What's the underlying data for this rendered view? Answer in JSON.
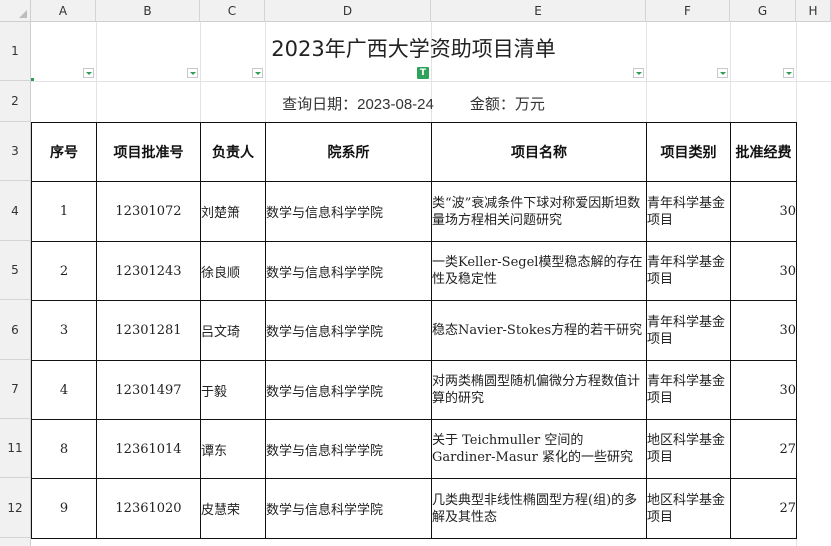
{
  "columns": [
    "A",
    "B",
    "C",
    "D",
    "E",
    "F",
    "G",
    "H"
  ],
  "rows": [
    "1",
    "2",
    "3",
    "4",
    "5",
    "6",
    "7",
    "11",
    "12"
  ],
  "title": "2023年广西大学资助项目清单",
  "subtitle": {
    "date_label": "查询日期：",
    "date_value": "2023-08-24",
    "amount_label": "金额：万元"
  },
  "filter_badge": "T",
  "headers": [
    "序号",
    "项目批准号",
    "负责人",
    "院系所",
    "项目名称",
    "项目类别",
    "批准经费"
  ],
  "records": [
    {
      "seq": "1",
      "code": "12301072",
      "leader": "刘楚箫",
      "dept": "数学与信息科学学院",
      "name": "类“波”衰减条件下球对称爱因斯坦数量场方程相关问题研究",
      "category": "青年科学基金项目",
      "funding": "30"
    },
    {
      "seq": "2",
      "code": "12301243",
      "leader": "徐良顺",
      "dept": "数学与信息科学学院",
      "name": "一类Keller-Segel模型稳态解的存在性及稳定性",
      "category": "青年科学基金项目",
      "funding": "30"
    },
    {
      "seq": "3",
      "code": "12301281",
      "leader": "吕文琦",
      "dept": "数学与信息科学学院",
      "name": "稳态Navier-Stokes方程的若干研究",
      "category": "青年科学基金项目",
      "funding": "30"
    },
    {
      "seq": "4",
      "code": "12301497",
      "leader": "于毅",
      "dept": "数学与信息科学学院",
      "name": "对两类椭圆型随机偏微分方程数值计算的研究",
      "category": "青年科学基金项目",
      "funding": "30"
    },
    {
      "seq": "8",
      "code": "12361014",
      "leader": "谭东",
      "dept": "数学与信息科学学院",
      "name": "关于 Teichmuller 空间的 Gardiner-Masur 紧化的一些研究",
      "category": "地区科学基金项目",
      "funding": "27"
    },
    {
      "seq": "9",
      "code": "12361020",
      "leader": "皮慧荣",
      "dept": "数学与信息科学学院",
      "name": "几类典型非线性椭圆型方程(组)的多解及其性态",
      "category": "地区科学基金项目",
      "funding": "27"
    }
  ]
}
